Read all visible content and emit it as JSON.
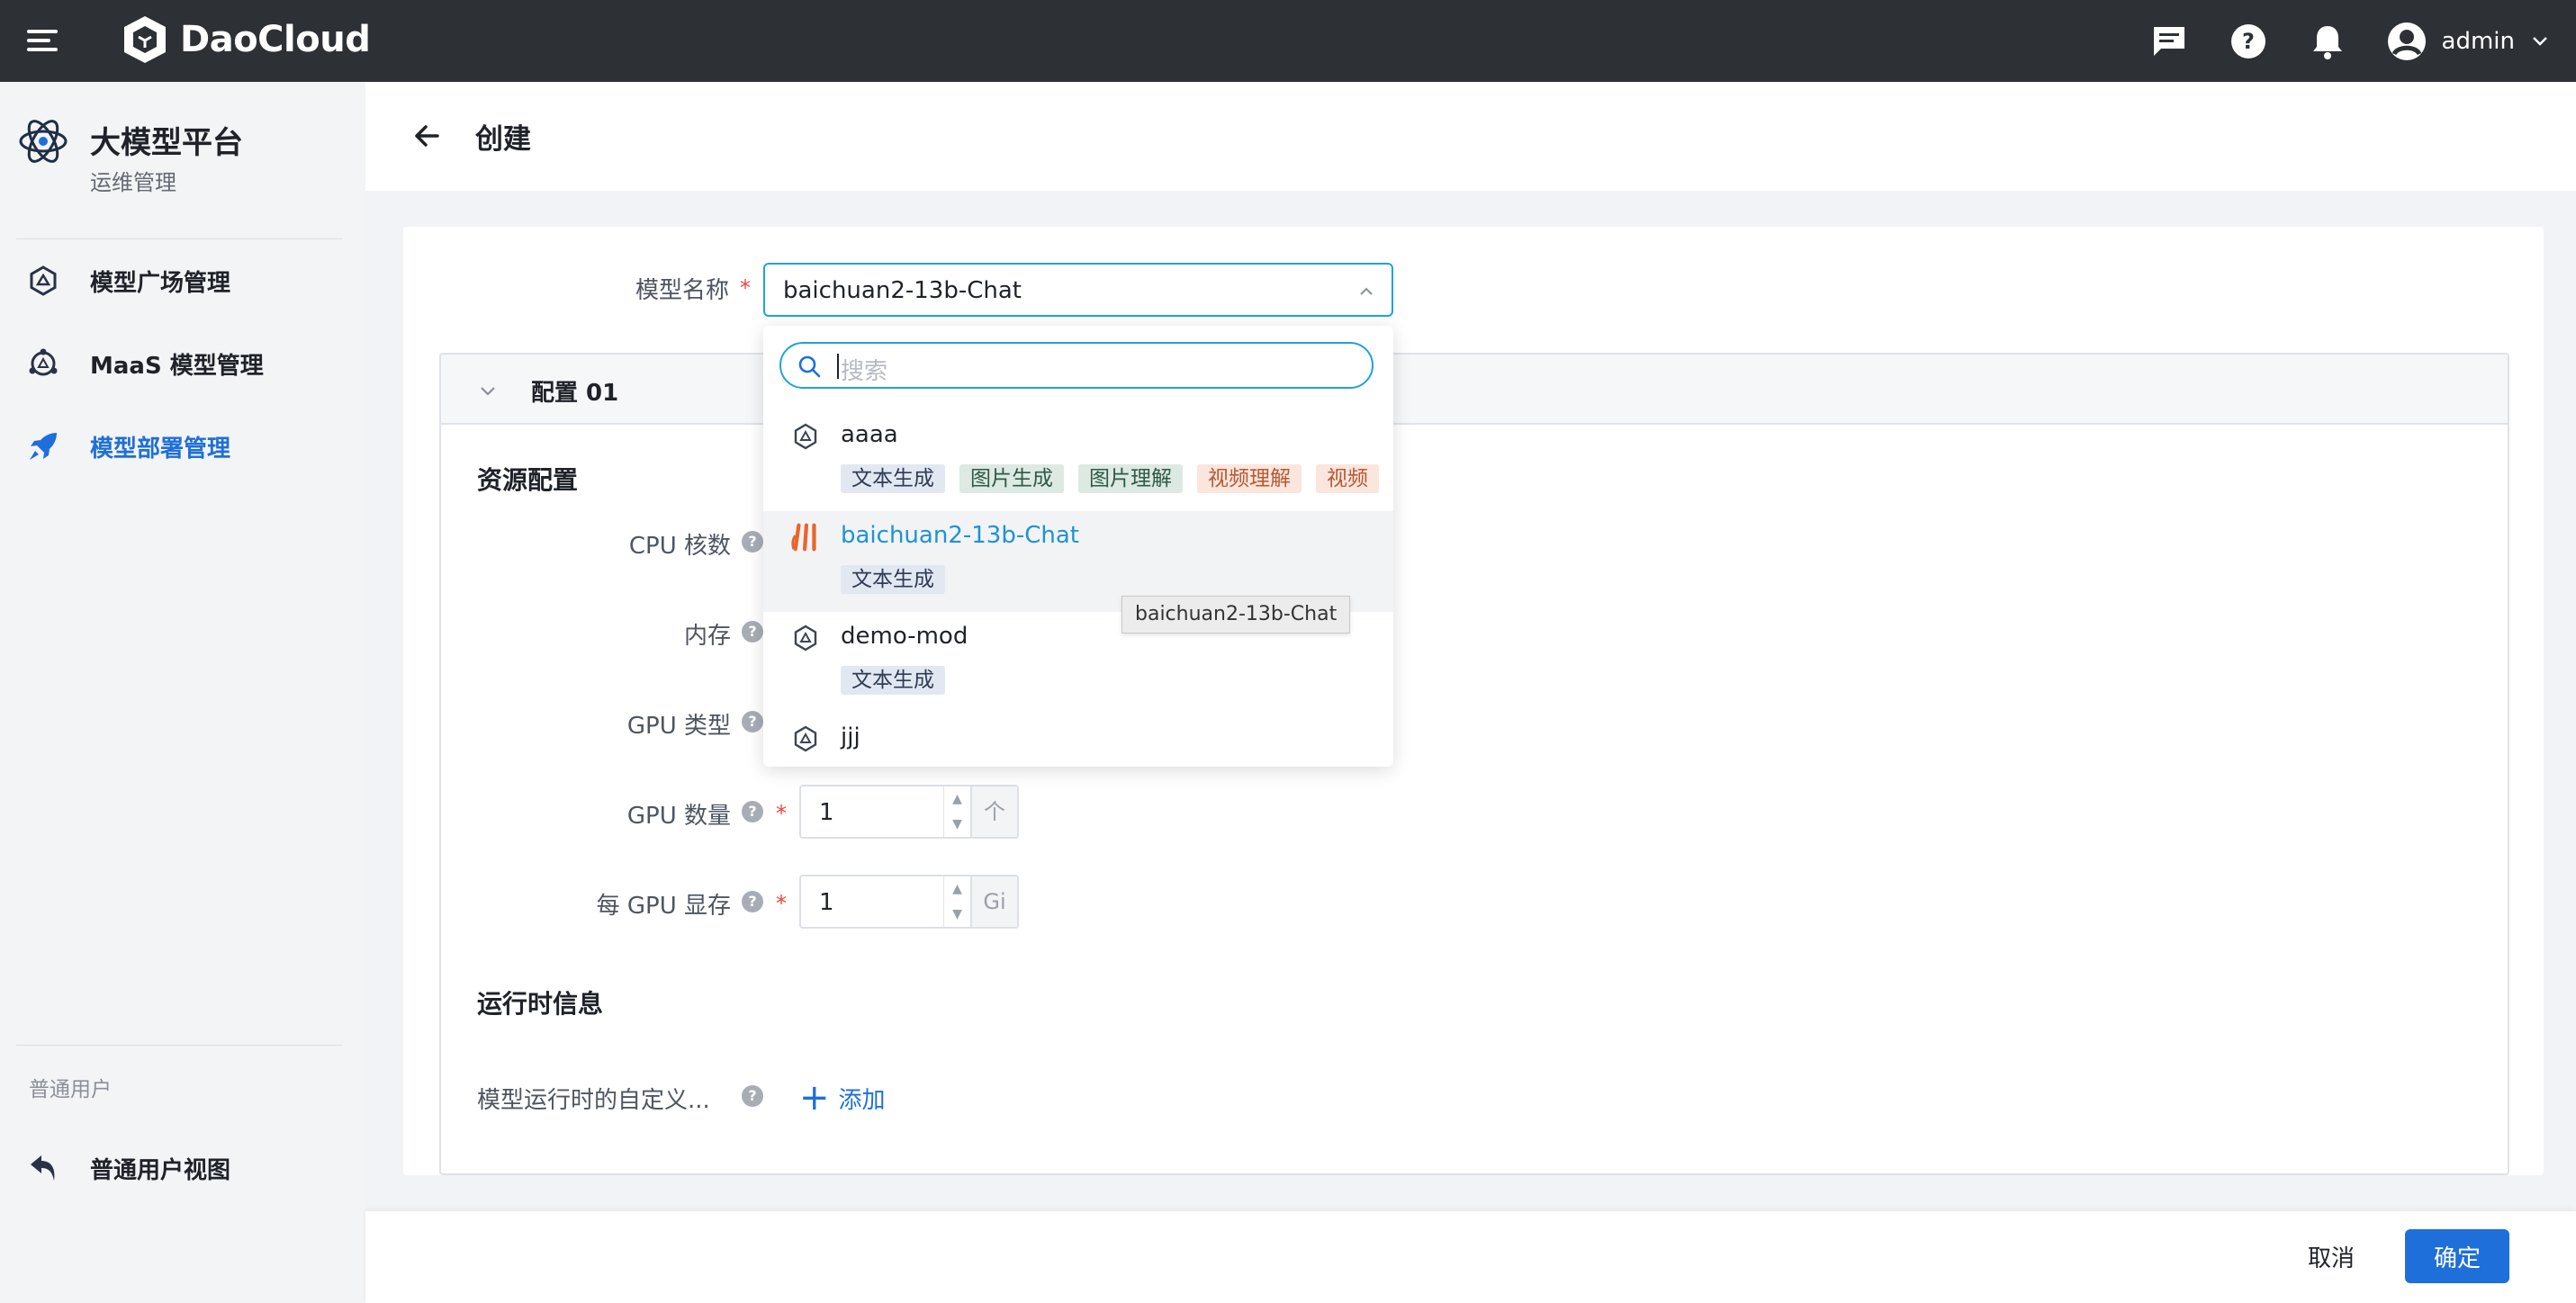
{
  "header": {
    "logo_text": "DaoCloud",
    "user_name": "admin"
  },
  "sidebar": {
    "title": "大模型平台",
    "subtitle": "运维管理",
    "items": [
      {
        "label": "模型广场管理"
      },
      {
        "label": "MaaS 模型管理"
      },
      {
        "label": "模型部署管理"
      }
    ],
    "section_label": "普通用户",
    "user_view": "普通用户视图"
  },
  "page": {
    "title": "创建"
  },
  "form": {
    "model_name_label": "模型名称",
    "model_name_value": "baichuan2-13b-Chat",
    "config_title": "配置 01",
    "resource_title": "资源配置",
    "cpu_label": "CPU 核数",
    "memory_label": "内存",
    "gpu_type_label": "GPU 类型",
    "gpu_count_label": "GPU 数量",
    "gpu_count_value": "1",
    "gpu_count_unit": "个",
    "gpu_mem_label": "每 GPU 显存",
    "gpu_mem_value": "1",
    "gpu_mem_unit": "Gi",
    "runtime_title": "运行时信息",
    "runtime_custom_label": "模型运行时的自定义...",
    "add_label": "添加"
  },
  "dropdown": {
    "search_placeholder": "搜索",
    "options": [
      {
        "name": "aaaa",
        "tags": [
          "文本生成",
          "图片生成",
          "图片理解",
          "视频理解",
          "视频"
        ]
      },
      {
        "name": "baichuan2-13b-Chat",
        "tags": [
          "文本生成"
        ]
      },
      {
        "name": "demo-mod",
        "tags": [
          "文本生成"
        ]
      },
      {
        "name": "jjj",
        "tags": []
      }
    ],
    "tooltip": "baichuan2-13b-Chat"
  },
  "footer": {
    "cancel_label": "取消",
    "ok_label": "确定"
  },
  "colors": {
    "topbar": "#2d3035",
    "primary": "#1e6fd9",
    "focus": "#1fa3d9"
  }
}
